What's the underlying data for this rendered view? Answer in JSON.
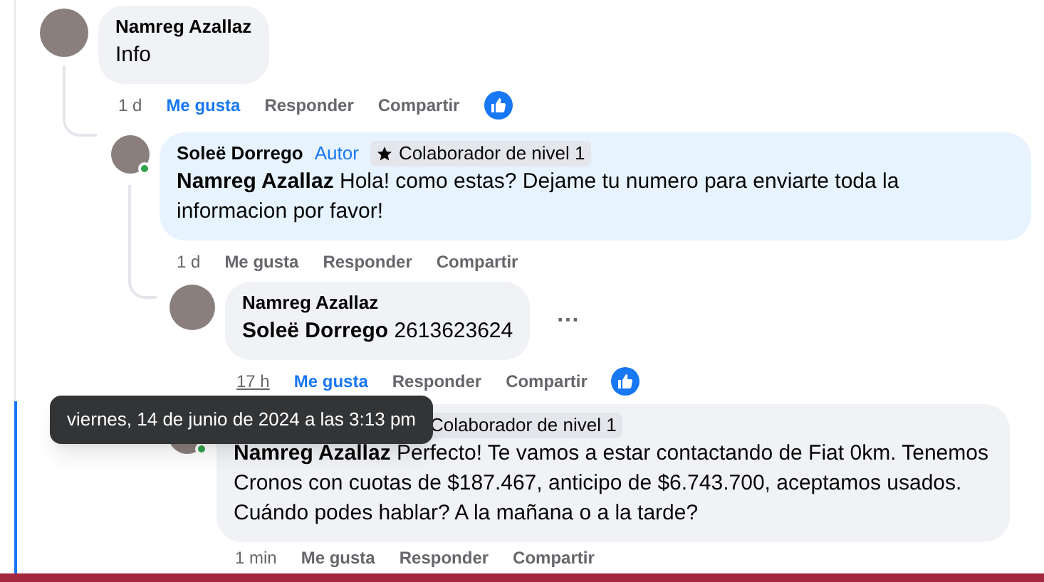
{
  "comments": [
    {
      "author": "Namreg Azallaz",
      "text": "Info",
      "online": false,
      "color": "#f0f2f5",
      "time": "1 d",
      "time_underlined": false,
      "like": {
        "label": "Me gusta",
        "liked": true
      },
      "reply": "Responder",
      "share": "Compartir",
      "reaction": true
    },
    {
      "author": "Soleë Dorrego",
      "author_tag": "Autor",
      "badge": "Colaborador de nivel 1",
      "text": "**Namreg Azallaz** Hola! como estas? Dejame tu numero para enviarte toda la informacion por favor!",
      "online": true,
      "color": "#e7f3ff",
      "time": "1 d",
      "time_underlined": false,
      "like": {
        "label": "Me gusta",
        "liked": false
      },
      "reply": "Responder",
      "share": "Compartir",
      "reaction": false
    },
    {
      "author": "Namreg Azallaz",
      "text": "**Soleë Dorrego** 2613623624",
      "online": false,
      "color": "#f0f2f5",
      "more": "···",
      "time": "17 h",
      "time_underlined": true,
      "like": {
        "label": "Me gusta",
        "liked": true
      },
      "reply": "Responder",
      "share": "Compartir",
      "reaction": true
    },
    {
      "badge": "Colaborador de nivel 1",
      "text": "**Namreg Azallaz** Perfecto! Te vamos a estar contactando de Fiat 0km. Tenemos Cronos con cuotas de $187.467, anticipo de $6.743.700, aceptamos usados. Cuándo podes hablar? A la mañana o a la tarde?",
      "online": true,
      "color": "#f0f2f5",
      "time": "1 min",
      "time_underlined": false,
      "like": {
        "label": "Me gusta",
        "liked": false
      },
      "reply": "Responder",
      "share": "Compartir",
      "reaction": false
    }
  ],
  "tooltip": "viernes, 14 de junio de 2024 a las 3:13 pm"
}
